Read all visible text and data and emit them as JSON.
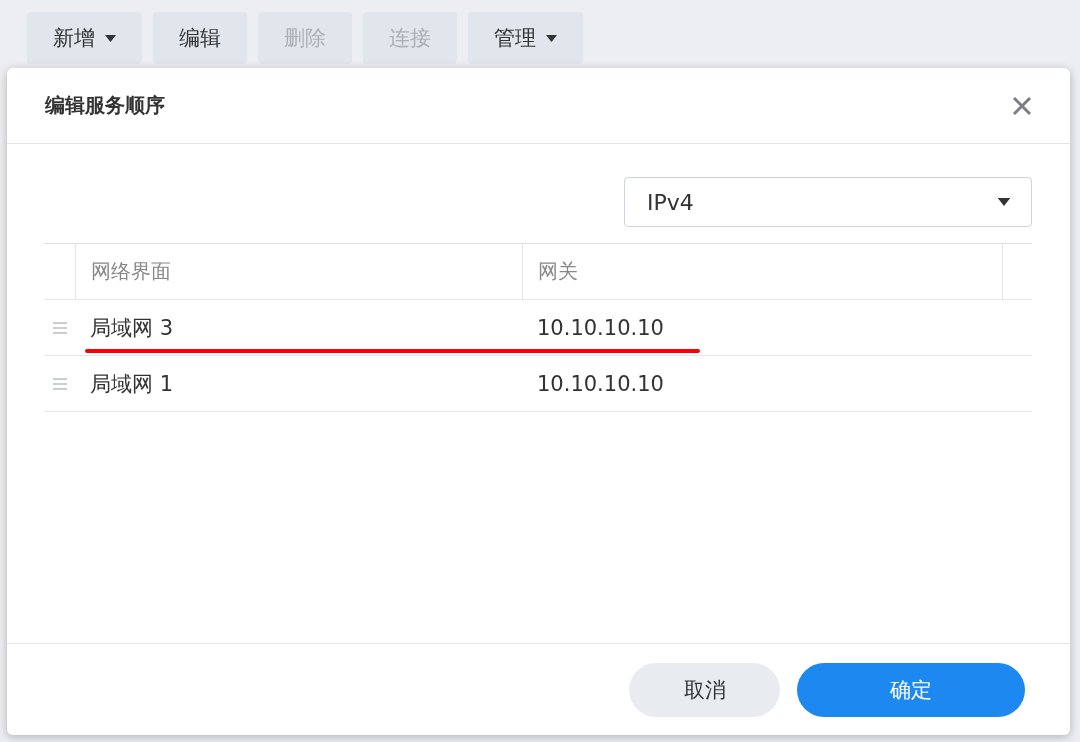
{
  "toolbar": [
    {
      "label": "新增",
      "dropdown": true,
      "disabled": false
    },
    {
      "label": "编辑",
      "dropdown": false,
      "disabled": false
    },
    {
      "label": "删除",
      "dropdown": false,
      "disabled": true
    },
    {
      "label": "连接",
      "dropdown": false,
      "disabled": true
    },
    {
      "label": "管理",
      "dropdown": true,
      "disabled": false
    }
  ],
  "dialog": {
    "title": "编辑服务顺序",
    "protocol_select": {
      "value": "IPv4"
    },
    "table": {
      "columns": [
        "网络界面",
        "网关"
      ],
      "rows": [
        {
          "interface": "局域网 3",
          "gateway": "10.10.10.10",
          "underlined": true
        },
        {
          "interface": "局域网 1",
          "gateway": "10.10.10.10",
          "underlined": false
        }
      ]
    },
    "buttons": [
      {
        "label": "取消",
        "kind": "secondary"
      },
      {
        "label": "确定",
        "kind": "primary"
      }
    ]
  }
}
